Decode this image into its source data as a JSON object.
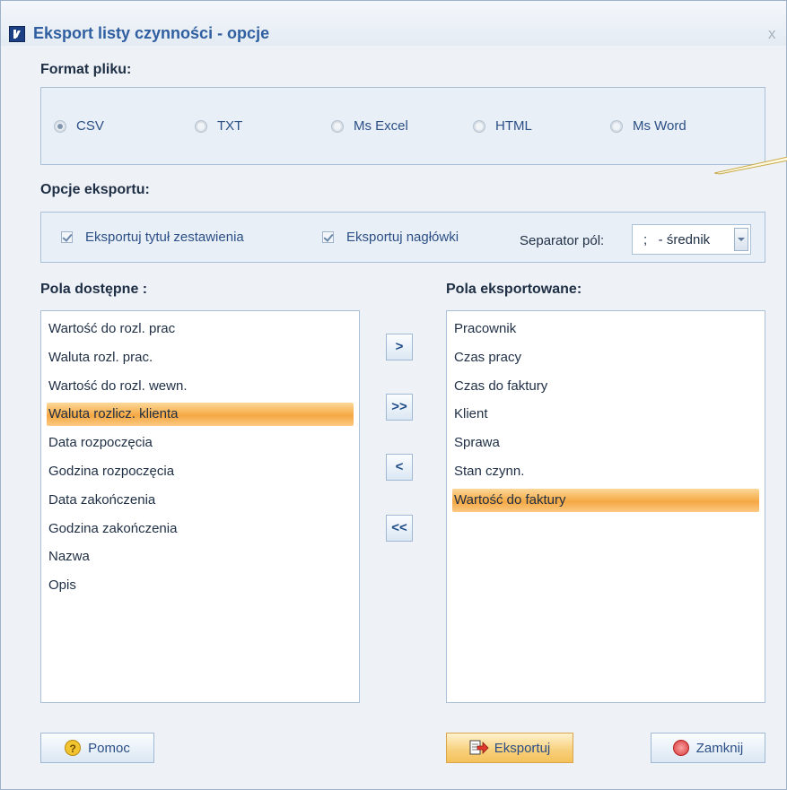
{
  "window": {
    "title": "Eksport listy czynności - opcje",
    "close_glyph": "x"
  },
  "format": {
    "label": "Format pliku:",
    "options": [
      {
        "label": "CSV",
        "checked": true
      },
      {
        "label": "TXT",
        "checked": false
      },
      {
        "label": "Ms Excel",
        "checked": false
      },
      {
        "label": "HTML",
        "checked": false
      },
      {
        "label": "Ms Word",
        "checked": false
      }
    ]
  },
  "export_options": {
    "label": "Opcje eksportu:",
    "export_title": {
      "label": "Eksportuj tytuł zestawienia",
      "checked": true
    },
    "export_headers": {
      "label": "Eksportuj nagłówki",
      "checked": true
    },
    "separator_label": "Separator pól:",
    "separator_value": ";   - średnik"
  },
  "available": {
    "label": "Pola dostępne :",
    "items": [
      "Wartość do rozl. prac",
      "Waluta rozl. prac.",
      "Wartość do rozl. wewn.",
      "Waluta rozlicz. klienta",
      "Data rozpoczęcia",
      "Godzina rozpoczęcia",
      "Data zakończenia",
      "Godzina zakończenia",
      "Nazwa",
      "Opis"
    ],
    "selected_index": 3
  },
  "exported": {
    "label": "Pola eksportowane:",
    "items": [
      "Pracownik",
      "Czas pracy",
      "Czas do faktury",
      "Klient",
      "Sprawa",
      "Stan czynn.",
      "Wartość do faktury"
    ],
    "selected_index": 6
  },
  "transfer_buttons": {
    "add": ">",
    "add_all": ">>",
    "remove": "<",
    "remove_all": "<<"
  },
  "footer": {
    "help": "Pomoc",
    "export": "Eksportuj",
    "close": "Zamknij"
  }
}
